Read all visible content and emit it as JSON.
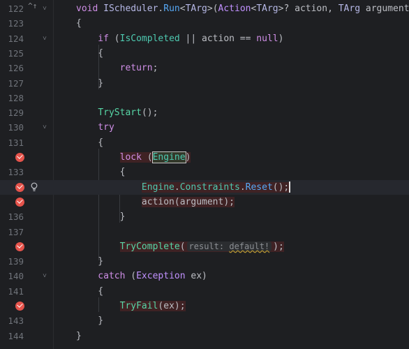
{
  "lines": [
    {
      "num": "122",
      "fold": "˅",
      "code": [
        [
          "void ",
          "kw"
        ],
        [
          "IScheduler",
          "ty"
        ],
        [
          ".",
          "plain"
        ],
        [
          "Run",
          "fn"
        ],
        [
          "<",
          "plain"
        ],
        [
          "TArg",
          "ty"
        ],
        [
          ">(",
          "plain"
        ],
        [
          "Action",
          "cls"
        ],
        [
          "<",
          "plain"
        ],
        [
          "TArg",
          "ty"
        ],
        [
          ">? action, ",
          "plain"
        ],
        [
          "TArg",
          "ty"
        ],
        [
          " argument)",
          "plain"
        ]
      ]
    },
    {
      "num": "123",
      "code": [
        [
          "{",
          "plain"
        ]
      ]
    },
    {
      "num": "124",
      "fold": "˅",
      "code": [
        [
          "    if",
          "kw"
        ],
        [
          " (",
          "plain"
        ],
        [
          "IsCompleted",
          "prop"
        ],
        [
          " || action == ",
          "plain"
        ],
        [
          "null",
          "kw"
        ],
        [
          ")",
          "plain"
        ]
      ]
    },
    {
      "num": "125",
      "code": [
        [
          "    {",
          "plain"
        ]
      ]
    },
    {
      "num": "126",
      "code": [
        [
          "        return",
          "kw"
        ],
        [
          ";",
          "plain"
        ]
      ]
    },
    {
      "num": "127",
      "code": [
        [
          "    }",
          "plain"
        ]
      ]
    },
    {
      "num": "128",
      "code": []
    },
    {
      "num": "129",
      "code": [
        [
          "    ",
          "plain"
        ],
        [
          "TryStart",
          "grn"
        ],
        [
          "();",
          "plain"
        ]
      ]
    },
    {
      "num": "130",
      "fold": "˅",
      "code": [
        [
          "    try",
          "kw"
        ]
      ]
    },
    {
      "num": "131",
      "code": [
        [
          "    {",
          "plain"
        ]
      ]
    },
    {
      "num": "",
      "bp": true,
      "code": [
        [
          "        ",
          "plain"
        ],
        [
          "lock",
          "kw"
        ],
        [
          " (",
          "plain"
        ],
        [
          "Engine",
          "prop"
        ],
        [
          ")",
          "plain"
        ]
      ],
      "highlight": true
    },
    {
      "num": "133",
      "code": [
        [
          "        {",
          "plain"
        ]
      ]
    },
    {
      "num": "",
      "bp": true,
      "bulb": true,
      "current": true,
      "code": [
        [
          "            ",
          "plain"
        ],
        [
          "Engine",
          "prop"
        ],
        [
          ".",
          "plain"
        ],
        [
          "Constraints",
          "prop"
        ],
        [
          ".",
          "plain"
        ],
        [
          "Reset",
          "meth"
        ],
        [
          "();",
          "plain"
        ]
      ],
      "highlight": true
    },
    {
      "num": "",
      "bp": true,
      "code": [
        [
          "            action(argument);",
          "plain"
        ]
      ],
      "highlight": true
    },
    {
      "num": "136",
      "code": [
        [
          "        }",
          "plain"
        ]
      ]
    },
    {
      "num": "137",
      "code": []
    },
    {
      "num": "",
      "bp": true,
      "code": [
        [
          "        ",
          "plain"
        ],
        [
          "TryComplete",
          "grn"
        ],
        [
          "(",
          "plain"
        ]
      ],
      "hint": {
        "label": "result:",
        "value": "default!"
      },
      "tail": ");",
      "highlight": true
    },
    {
      "num": "139",
      "code": [
        [
          "    }",
          "plain"
        ]
      ]
    },
    {
      "num": "140",
      "fold": "˅",
      "code": [
        [
          "    catch",
          "kw"
        ],
        [
          " (",
          "plain"
        ],
        [
          "Exception",
          "cls"
        ],
        [
          " ex)",
          "plain"
        ]
      ]
    },
    {
      "num": "141",
      "code": [
        [
          "    {",
          "plain"
        ]
      ]
    },
    {
      "num": "",
      "bp": true,
      "code": [
        [
          "        ",
          "plain"
        ],
        [
          "TryFail",
          "grn"
        ],
        [
          "(ex);",
          "plain"
        ]
      ],
      "highlight": true
    },
    {
      "num": "143",
      "code": [
        [
          "    }",
          "plain"
        ]
      ]
    },
    {
      "num": "144",
      "code": [
        [
          "}",
          "plain"
        ]
      ]
    }
  ],
  "gutter_top_icons": "^↑"
}
